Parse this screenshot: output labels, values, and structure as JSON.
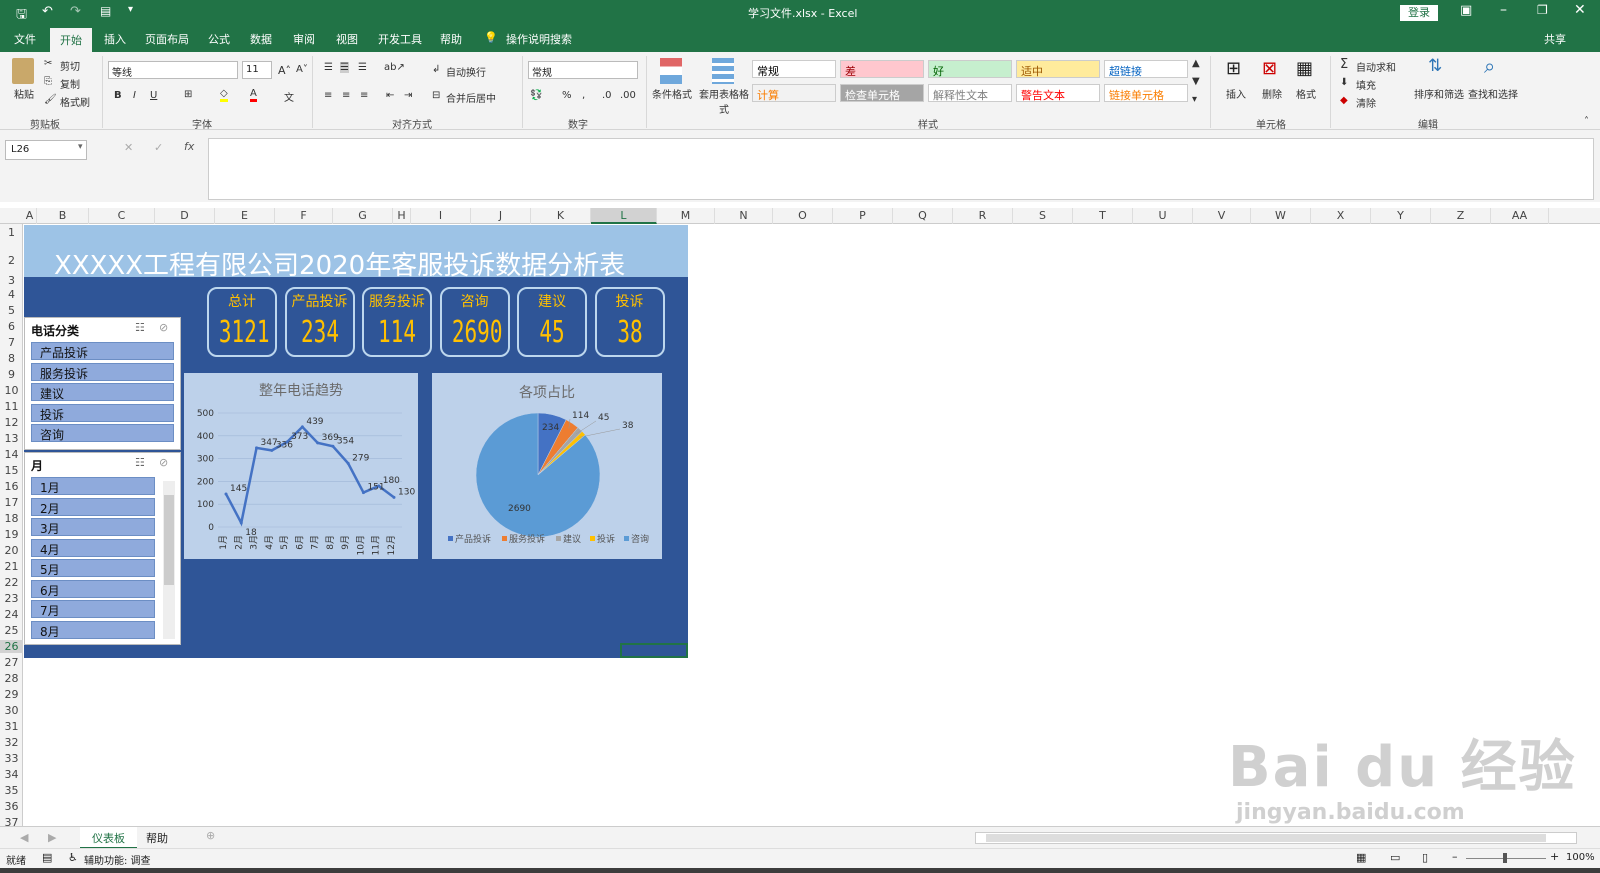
{
  "window": {
    "title": "学习文件.xlsx  -  Excel",
    "login": "登录",
    "share": "共享"
  },
  "tabs": [
    "文件",
    "开始",
    "插入",
    "页面布局",
    "公式",
    "数据",
    "审阅",
    "视图",
    "开发工具",
    "帮助"
  ],
  "search_tip": "操作说明搜索",
  "ribbon": {
    "clipboard": {
      "paste": "粘贴",
      "cut": "剪切",
      "copy": "复制",
      "format_painter": "格式刷",
      "label": "剪贴板"
    },
    "font": {
      "name": "等线",
      "size": "11",
      "label": "字体"
    },
    "alignment": {
      "wrap": "自动换行",
      "merge": "合并后居中",
      "label": "对齐方式"
    },
    "number": {
      "format": "常规",
      "label": "数字"
    },
    "styles": {
      "cond": "条件格式",
      "table": "套用表格格式",
      "label": "样式",
      "cells": [
        {
          "t": "常规",
          "bg": "#ffffff",
          "c": "#000000"
        },
        {
          "t": "差",
          "bg": "#ffc7ce",
          "c": "#9c0006"
        },
        {
          "t": "好",
          "bg": "#c6efce",
          "c": "#006100"
        },
        {
          "t": "适中",
          "bg": "#ffeb9c",
          "c": "#9c5700"
        },
        {
          "t": "超链接",
          "bg": "#ffffff",
          "c": "#0563c1"
        },
        {
          "t": "计算",
          "bg": "#f2f2f2",
          "c": "#fa7d00"
        },
        {
          "t": "检查单元格",
          "bg": "#a5a5a5",
          "c": "#ffffff"
        },
        {
          "t": "解释性文本",
          "bg": "#ffffff",
          "c": "#7f7f7f"
        },
        {
          "t": "警告文本",
          "bg": "#ffffff",
          "c": "#ff0000"
        },
        {
          "t": "链接单元格",
          "bg": "#ffffff",
          "c": "#fa7d00"
        }
      ]
    },
    "cells": {
      "insert": "插入",
      "delete": "删除",
      "format": "格式",
      "label": "单元格"
    },
    "editing": {
      "autosum": "自动求和",
      "fill": "填充",
      "clear": "清除",
      "sort": "排序和筛选",
      "find": "查找和选择",
      "label": "编辑"
    }
  },
  "namebox": "L26",
  "columns": [
    "A",
    "B",
    "C",
    "D",
    "E",
    "F",
    "G",
    "H",
    "I",
    "J",
    "K",
    "L",
    "M",
    "N",
    "O",
    "P",
    "Q",
    "R",
    "S",
    "T",
    "U",
    "V",
    "W",
    "X",
    "Y",
    "Z",
    "AA"
  ],
  "rows": [
    "1",
    "2",
    "3",
    "4",
    "5",
    "6",
    "7",
    "8",
    "9",
    "10",
    "11",
    "12",
    "13",
    "14",
    "15",
    "16",
    "17",
    "18",
    "19",
    "20",
    "21",
    "22",
    "23",
    "24",
    "25",
    "26",
    "27",
    "28",
    "29",
    "30",
    "31",
    "32",
    "33",
    "34",
    "35",
    "36",
    "37"
  ],
  "dashboard": {
    "title": "XXXXX工程有限公司2020年客服投诉数据分析表",
    "kpis": [
      {
        "label": "总计",
        "value": "3121"
      },
      {
        "label": "产品投诉",
        "value": "234"
      },
      {
        "label": "服务投诉",
        "value": "114"
      },
      {
        "label": "咨询",
        "value": "2690"
      },
      {
        "label": "建议",
        "value": "45"
      },
      {
        "label": "投诉",
        "value": "38"
      }
    ],
    "slicer1": {
      "title": "电话分类",
      "items": [
        "产品投诉",
        "服务投诉",
        "建议",
        "投诉",
        "咨询"
      ]
    },
    "slicer2": {
      "title": "月",
      "items": [
        "1月",
        "2月",
        "3月",
        "4月",
        "5月",
        "6月",
        "7月",
        "8月"
      ]
    }
  },
  "chart_data": [
    {
      "type": "line",
      "title": "整年电话趋势",
      "categories": [
        "1月",
        "2月",
        "3月",
        "4月",
        "5月",
        "6月",
        "7月",
        "8月",
        "9月",
        "10月",
        "11月",
        "12月"
      ],
      "values": [
        145,
        18,
        347,
        336,
        373,
        439,
        369,
        354,
        279,
        151,
        180,
        130
      ],
      "ylim": [
        0,
        500
      ],
      "yticks": [
        0,
        100,
        200,
        300,
        400,
        500
      ],
      "color": "#4472c4"
    },
    {
      "type": "pie",
      "title": "各项占比",
      "categories": [
        "产品投诉",
        "服务投诉",
        "建议",
        "投诉",
        "咨询"
      ],
      "values": [
        234,
        114,
        45,
        38,
        2690
      ],
      "colors": [
        "#4472c4",
        "#ed7d31",
        "#a5a5a5",
        "#ffc000",
        "#5b9bd5"
      ]
    }
  ],
  "sheets": [
    "仪表板",
    "帮助"
  ],
  "status": {
    "ready": "就绪",
    "accessibility": "辅助功能: 调查",
    "zoom": "100%"
  }
}
